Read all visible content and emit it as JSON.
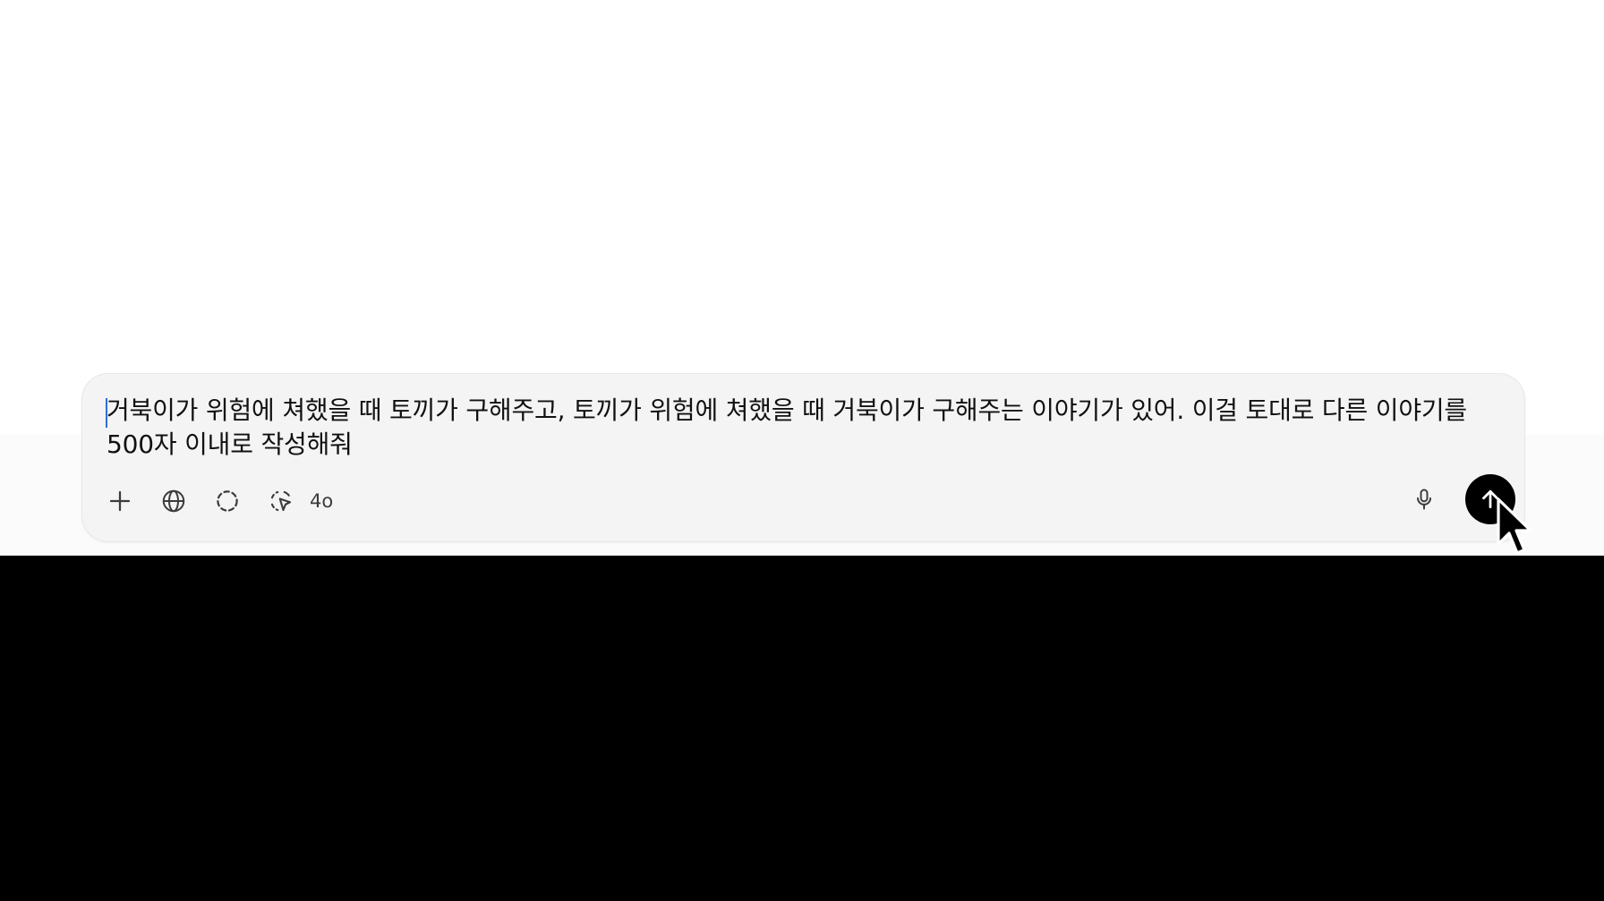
{
  "composer": {
    "prompt_text": "거북이가 위험에 쳐했을 때 토끼가 구해주고, 토끼가 위험에 쳐했을 때 거북이가 구해주는 이야기가 있어. 이걸 토대로 다른 이야기를 500자 이내로 작성해줘",
    "model_label": "4o"
  },
  "icons": {
    "add": "plus-icon",
    "search": "globe-icon",
    "reason": "dashed-circle-icon",
    "select": "selection-cursor-icon",
    "voice": "microphone-icon",
    "send": "arrow-up-icon",
    "pointer": "mouse-pointer-icon"
  },
  "colors": {
    "composer_bg": "#f4f4f4",
    "send_button": "#000000",
    "caret": "#2d6cdf"
  }
}
